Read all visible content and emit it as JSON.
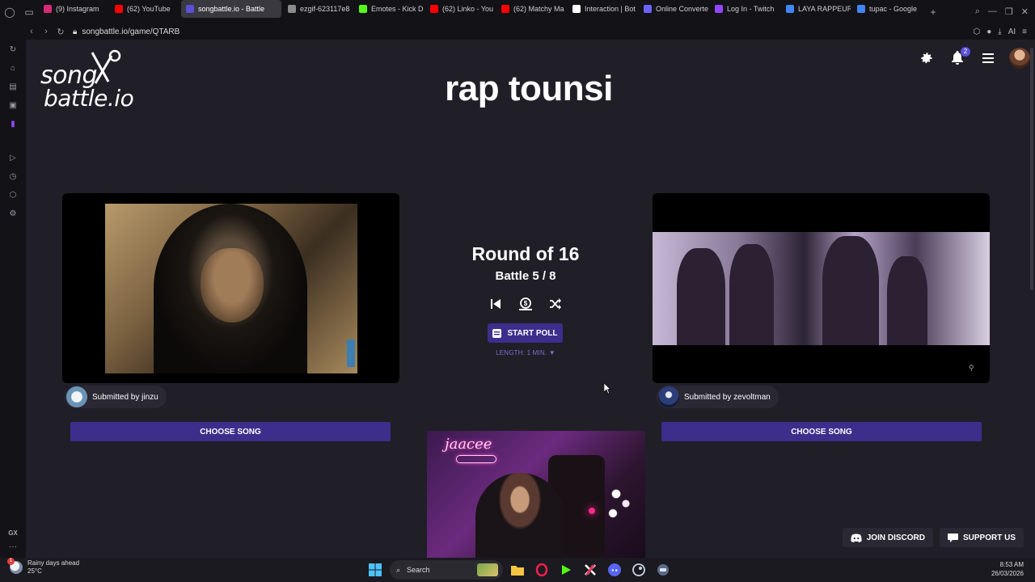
{
  "browser": {
    "tabs": [
      {
        "label": "(9) Instagram",
        "color": "#d62976"
      },
      {
        "label": "(62) YouTube",
        "color": "#ff0000"
      },
      {
        "label": "songbattle.io - Battle",
        "color": "#5b4fd6",
        "active": true
      },
      {
        "label": "ezgif-623117e8",
        "color": "#8a8a8a"
      },
      {
        "label": "Emotes - Kick D",
        "color": "#53fc18"
      },
      {
        "label": "(62) Linko - You",
        "color": "#ff0000"
      },
      {
        "label": "(62) Matchy Ma",
        "color": "#ff0000"
      },
      {
        "label": "Interaction | Bot",
        "color": "#ffffff"
      },
      {
        "label": "Online Converte",
        "color": "#6c63ff"
      },
      {
        "label": "Log In - Twitch",
        "color": "#9146ff"
      },
      {
        "label": "LAYA RAPPEUR",
        "color": "#4285f4"
      },
      {
        "label": "tupac - Google",
        "color": "#4285f4"
      }
    ],
    "url": "songbattle.io/game/QTARB",
    "ai_label": "AI"
  },
  "sidebar": {
    "gx_label": "GX",
    "icons": [
      "refresh-icon",
      "shop-icon",
      "wallet-icon",
      "m-icon",
      "twitch-icon",
      "play-circle-icon",
      "history-icon",
      "cube-icon",
      "settings-icon"
    ]
  },
  "header": {
    "logo_line1": "song",
    "logo_line2": "battle.io",
    "title": "rap tounsi",
    "notification_count": "2"
  },
  "battle": {
    "round": "Round of 16",
    "battle_progress": "Battle 5 / 8",
    "start_poll_label": "START POLL",
    "length_label": "LENGTH: 1 MIN. ▼"
  },
  "songs": {
    "left": {
      "submitter": "Submitted by jinzu",
      "choose_label": "CHOOSE SONG"
    },
    "right": {
      "submitter": "Submitted by zevoltman",
      "choose_label": "CHOOSE SONG"
    }
  },
  "webcam": {
    "neon_text": "jaacee"
  },
  "footer_buttons": {
    "discord": "JOIN DISCORD",
    "support": "SUPPORT US"
  },
  "taskbar": {
    "weather_title": "Rainy days ahead",
    "weather_temp": "25°C",
    "weather_badge": "1",
    "search_label": "Search",
    "time": "8:53 AM",
    "date": "26/03/2026"
  },
  "colors": {
    "accent": "#3d2e8c",
    "page_bg": "#201e27",
    "length_text": "#7e6fd6"
  }
}
